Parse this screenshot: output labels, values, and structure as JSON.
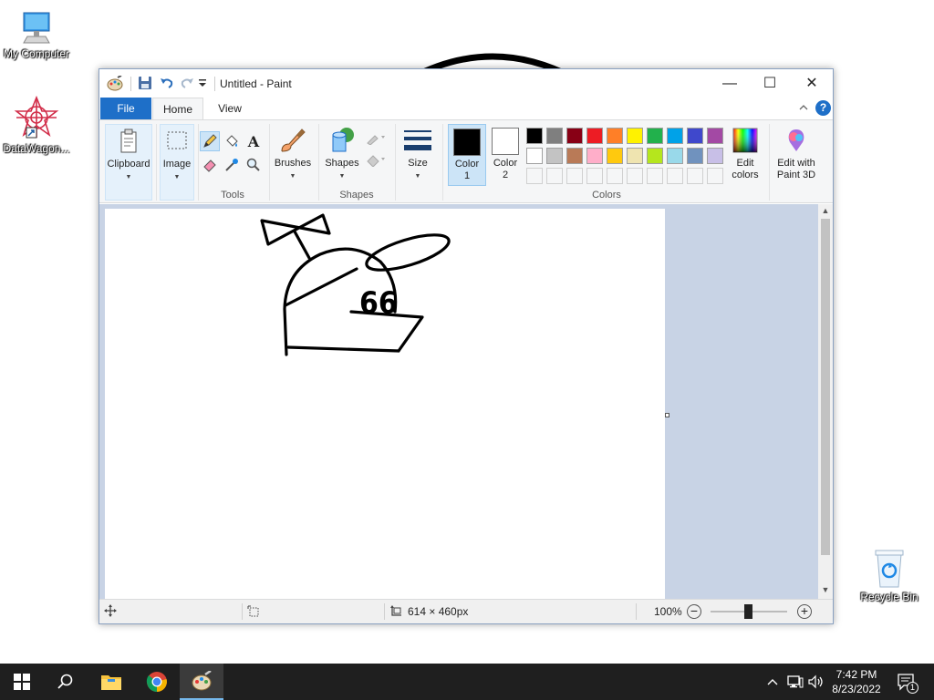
{
  "desktop": {
    "icons": [
      {
        "label": "My Computer"
      },
      {
        "label": "DataWagon..."
      },
      {
        "label": "Recycle Bin"
      }
    ]
  },
  "window": {
    "title": "Untitled - Paint",
    "controls": {
      "minimize": "—",
      "maximize": "☐",
      "close": "✕"
    }
  },
  "menu": {
    "tabs": [
      {
        "label": "File"
      },
      {
        "label": "Home"
      },
      {
        "label": "View"
      }
    ],
    "help": "?"
  },
  "ribbon": {
    "clipboard": {
      "label": "Clipboard"
    },
    "image": {
      "label": "Image"
    },
    "tools": {
      "label": "Tools"
    },
    "brushes": {
      "label": "Brushes"
    },
    "shapes": {
      "button": "Shapes",
      "group": "Shapes"
    },
    "size": {
      "label": "Size"
    },
    "color1": {
      "label1": "Color",
      "label2": "1",
      "value": "#000000"
    },
    "color2": {
      "label1": "Color",
      "label2": "2",
      "value": "#ffffff"
    },
    "colors_group": "Colors",
    "edit_colors": {
      "line1": "Edit",
      "line2": "colors"
    },
    "edit_paint3d": {
      "line1": "Edit with",
      "line2": "Paint 3D"
    },
    "palette": [
      [
        "#000000",
        "#7f7f7f",
        "#880015",
        "#ed1c24",
        "#ff7f27",
        "#fff200",
        "#22b14c",
        "#00a2e8",
        "#3f48cc",
        "#a349a4"
      ],
      [
        "#ffffff",
        "#c3c3c3",
        "#b97a57",
        "#ffaec9",
        "#ffc90e",
        "#efe4b0",
        "#b5e61d",
        "#99d9ea",
        "#7092be",
        "#c8bfe7"
      ]
    ]
  },
  "status": {
    "canvas_size": "614 × 460px",
    "zoom": "100%"
  },
  "taskbar": {
    "time": "7:42 PM",
    "date": "8/23/2022",
    "notification_count": "1"
  }
}
